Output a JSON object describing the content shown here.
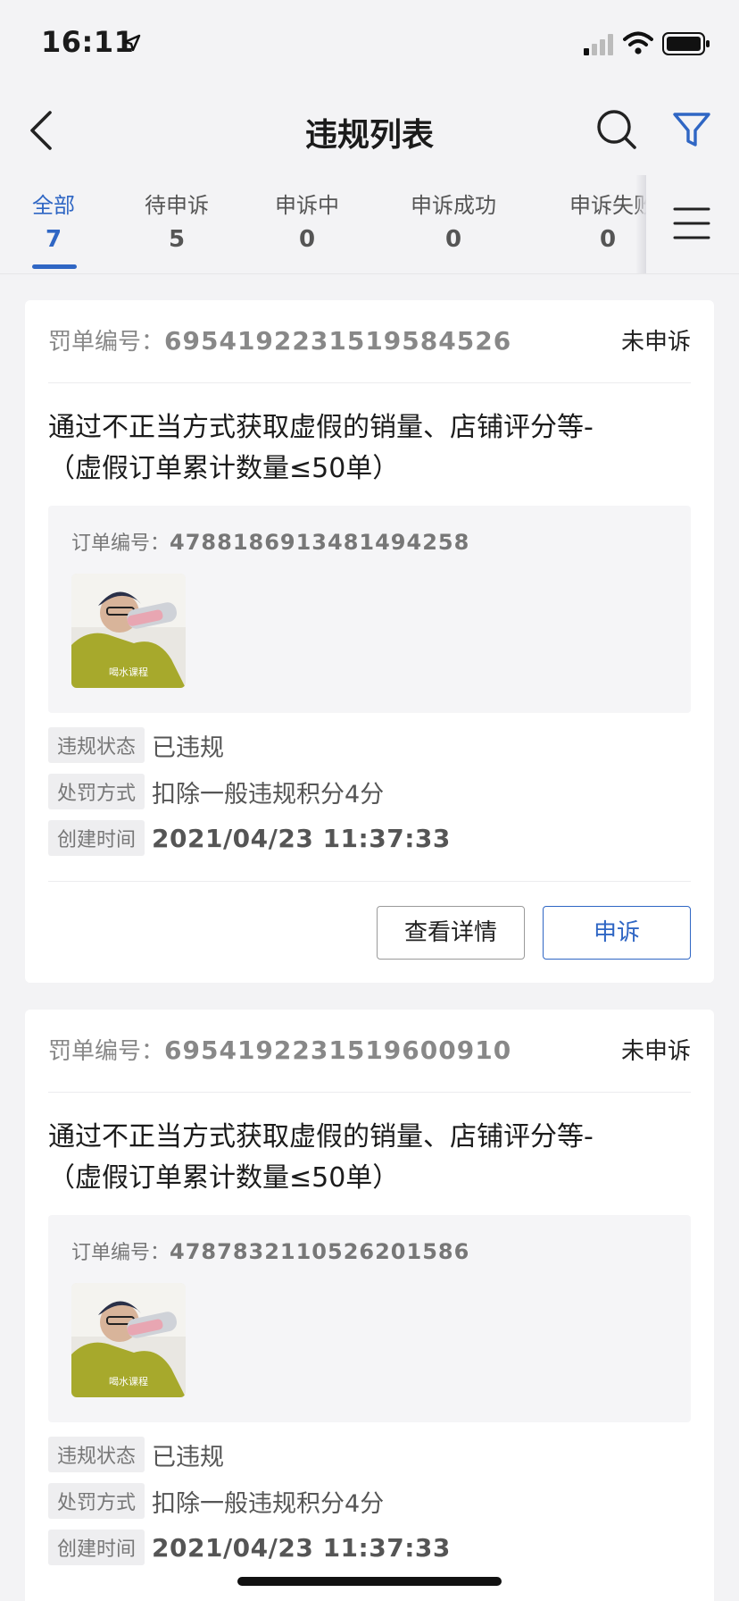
{
  "status_bar": {
    "time": "16:11",
    "icons": [
      "location-arrow-icon",
      "signal-icon",
      "wifi-icon",
      "battery-icon"
    ]
  },
  "nav": {
    "title": "违规列表",
    "icons": [
      "back-icon",
      "search-icon",
      "filter-icon"
    ]
  },
  "tabs": [
    {
      "label": "全部",
      "count": "7",
      "active": true
    },
    {
      "label": "待申诉",
      "count": "5",
      "active": false
    },
    {
      "label": "申诉中",
      "count": "0",
      "active": false
    },
    {
      "label": "申诉成功",
      "count": "0",
      "active": false
    },
    {
      "label": "申诉失败",
      "count": "0",
      "active": false
    }
  ],
  "colors": {
    "accent": "#2f66c4",
    "background": "#f3f3f5",
    "card": "#ffffff"
  },
  "cards": [
    {
      "ticket_label": "罚单编号：",
      "ticket_no": "6954192231519584526",
      "status": "未申诉",
      "title_line1": "通过不正当方式获取虚假的销量、店铺评分等-",
      "title_line2": "（虚假订单累计数量≤50单）",
      "order_label": "订单编号：",
      "order_no": "4788186913481494258",
      "thumb_caption": "喝水课程",
      "rows": [
        {
          "tag": "违规状态",
          "value": "已违规"
        },
        {
          "tag": "处罚方式",
          "value": "扣除一般违规积分4分"
        },
        {
          "tag": "创建时间",
          "value": "2021/04/23 11:37:33"
        }
      ],
      "detail_button": "查看详情",
      "appeal_button": "申诉"
    },
    {
      "ticket_label": "罚单编号：",
      "ticket_no": "6954192231519600910",
      "status": "未申诉",
      "title_line1": "通过不正当方式获取虚假的销量、店铺评分等-",
      "title_line2": "（虚假订单累计数量≤50单）",
      "order_label": "订单编号：",
      "order_no": "4787832110526201586",
      "thumb_caption": "喝水课程",
      "rows": [
        {
          "tag": "违规状态",
          "value": "已违规"
        },
        {
          "tag": "处罚方式",
          "value": "扣除一般违规积分4分"
        },
        {
          "tag": "创建时间",
          "value": "2021/04/23 11:37:33"
        }
      ]
    }
  ]
}
